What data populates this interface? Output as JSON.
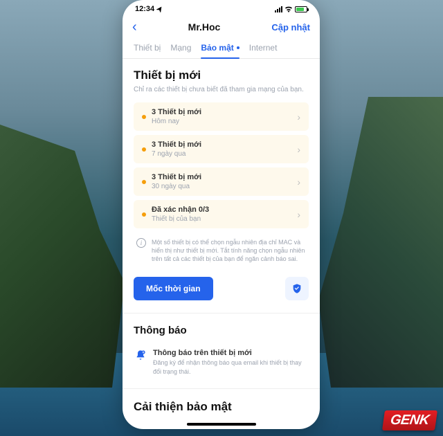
{
  "status": {
    "time": "12:34"
  },
  "nav": {
    "title": "Mr.Hoc",
    "action": "Cập nhật"
  },
  "tabs": [
    {
      "label": "Thiết bị"
    },
    {
      "label": "Mạng"
    },
    {
      "label": "Bảo mật"
    },
    {
      "label": "Internet"
    }
  ],
  "section": {
    "title": "Thiết bị mới",
    "subtitle": "Chỉ ra các thiết bị chưa biết đã tham gia mạng của bạn."
  },
  "rows": [
    {
      "title": "3 Thiết bị mới",
      "sub": "Hôm nay"
    },
    {
      "title": "3 Thiết bị mới",
      "sub": "7 ngày qua"
    },
    {
      "title": "3 Thiết bị mới",
      "sub": "30 ngày qua"
    },
    {
      "title": "Đã xác nhận 0/3",
      "sub": "Thiết bị của bạn"
    }
  ],
  "info": "Một số thiết bị có thể chọn ngẫu nhiên địa chỉ MAC và hiển thị như thiết bị mới. Tắt tính năng chọn ngẫu nhiên trên tất cả các thiết bị của bạn để ngăn cảnh báo sai.",
  "actions": {
    "timeline": "Mốc thời gian"
  },
  "notif": {
    "heading": "Thông báo",
    "title": "Thông báo trên thiết bị mới",
    "sub": "Đăng ký để nhận thông báo qua email khi thiết bị thay đổi trạng thái."
  },
  "improve": {
    "heading": "Cải thiện bảo mật"
  },
  "brand": {
    "a": "GEN",
    "b": "K"
  }
}
